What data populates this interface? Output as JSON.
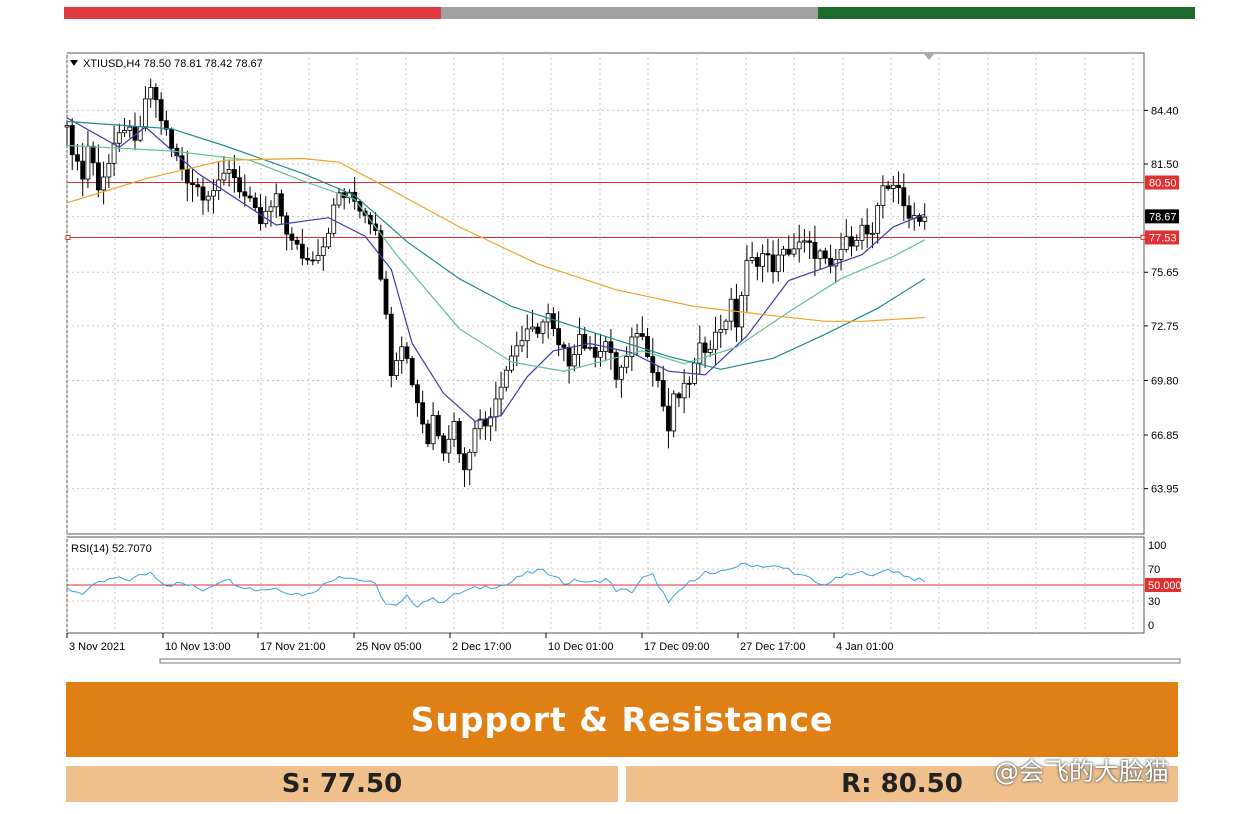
{
  "colors": {
    "bar_red": "#e0393e",
    "bar_grey": "#a0a0a0",
    "bar_green": "#1e6b2d",
    "banner": "#e07f14",
    "level_box": "#f0c08c",
    "level_line": "#e23030",
    "ma_fast": "#3b3bb0",
    "ma_mid": "#5cc494",
    "ma_slow": "#1e8c8c",
    "ma_long": "#f5a020",
    "rsi": "#3d9fe6"
  },
  "chart_data": {
    "type": "candlestick",
    "title": "XTIUSD,H4 78.50 78.81 78.42 78.67",
    "ylim": [
      61.5,
      87.5
    ],
    "y_ticks": [
      "84.40",
      "81.50",
      "78.67",
      "75.65",
      "72.75",
      "69.80",
      "66.85",
      "63.95"
    ],
    "x_ticks": [
      "3 Nov 2021",
      "10 Nov 13:00",
      "17 Nov 21:00",
      "25 Nov 05:00",
      "2 Dec 17:00",
      "10 Dec 01:00",
      "17 Dec 09:00",
      "27 Dec 17:00",
      "4 Jan 01:00"
    ],
    "close_path": [
      [
        0,
        83.2
      ],
      [
        3,
        80.8
      ],
      [
        4,
        82.5
      ],
      [
        6,
        80.4
      ],
      [
        8,
        81.5
      ],
      [
        11,
        83.6
      ],
      [
        13,
        82.5
      ],
      [
        16,
        85.7
      ],
      [
        18,
        84.0
      ],
      [
        20,
        82.3
      ],
      [
        23,
        80.8
      ],
      [
        26,
        80.0
      ],
      [
        29,
        80.2
      ],
      [
        31,
        81.4
      ],
      [
        34,
        79.7
      ],
      [
        37,
        78.3
      ],
      [
        40,
        79.5
      ],
      [
        43,
        77.2
      ],
      [
        46,
        76.3
      ],
      [
        49,
        77.2
      ],
      [
        52,
        79.9
      ],
      [
        55,
        79.5
      ],
      [
        57,
        78.9
      ],
      [
        59,
        78.2
      ],
      [
        61,
        73.1
      ],
      [
        62,
        70.5
      ],
      [
        64,
        72.0
      ],
      [
        67,
        68.7
      ],
      [
        69,
        66.5
      ],
      [
        70,
        67.9
      ],
      [
        72,
        66.3
      ],
      [
        74,
        67.5
      ],
      [
        76,
        64.8
      ],
      [
        78,
        67.6
      ],
      [
        80,
        67.4
      ],
      [
        83,
        69.8
      ],
      [
        86,
        71.8
      ],
      [
        89,
        72.4
      ],
      [
        92,
        73.2
      ],
      [
        94,
        71.5
      ],
      [
        96,
        70.9
      ],
      [
        98,
        72.3
      ],
      [
        100,
        71.2
      ],
      [
        103,
        71.9
      ],
      [
        105,
        70.0
      ],
      [
        107,
        70.9
      ],
      [
        109,
        72.6
      ],
      [
        111,
        71.5
      ],
      [
        113,
        69.8
      ],
      [
        115,
        67.1
      ],
      [
        116,
        68.7
      ],
      [
        118,
        69.2
      ],
      [
        120,
        70.5
      ],
      [
        121,
        71.4
      ],
      [
        124,
        72.2
      ],
      [
        127,
        73.8
      ],
      [
        128,
        72.9
      ],
      [
        130,
        76.0
      ],
      [
        133,
        76.6
      ],
      [
        135,
        76.0
      ],
      [
        138,
        76.9
      ],
      [
        141,
        77.1
      ],
      [
        144,
        76.6
      ],
      [
        146,
        75.6
      ],
      [
        148,
        76.9
      ],
      [
        150,
        77.5
      ],
      [
        152,
        78.0
      ],
      [
        154,
        77.4
      ],
      [
        156,
        80.3
      ],
      [
        158,
        80.5
      ],
      [
        160,
        79.2
      ],
      [
        162,
        78.7
      ],
      [
        164,
        78.67
      ]
    ],
    "moving_averages": [
      {
        "name": "MA fast",
        "points": [
          [
            0,
            84.0
          ],
          [
            10,
            82.4
          ],
          [
            15,
            83.5
          ],
          [
            25,
            81.0
          ],
          [
            40,
            78.2
          ],
          [
            50,
            78.6
          ],
          [
            57,
            77.6
          ],
          [
            62,
            75.8
          ],
          [
            66,
            71.8
          ],
          [
            72,
            69.1
          ],
          [
            78,
            67.6
          ],
          [
            83,
            67.9
          ],
          [
            88,
            70.0
          ],
          [
            93,
            71.4
          ],
          [
            100,
            71.8
          ],
          [
            108,
            71.3
          ],
          [
            115,
            70.3
          ],
          [
            122,
            70.1
          ],
          [
            130,
            72.2
          ],
          [
            138,
            75.2
          ],
          [
            145,
            75.9
          ],
          [
            152,
            76.6
          ],
          [
            158,
            78.1
          ],
          [
            164,
            78.8
          ]
        ]
      },
      {
        "name": "MA mid",
        "points": [
          [
            0,
            82.5
          ],
          [
            20,
            82.2
          ],
          [
            35,
            81.7
          ],
          [
            45,
            80.6
          ],
          [
            55,
            79.6
          ],
          [
            63,
            76.6
          ],
          [
            75,
            72.6
          ],
          [
            85,
            70.8
          ],
          [
            95,
            70.3
          ],
          [
            110,
            71.4
          ],
          [
            118,
            70.7
          ],
          [
            128,
            71.6
          ],
          [
            138,
            73.5
          ],
          [
            148,
            75.3
          ],
          [
            158,
            76.5
          ],
          [
            164,
            77.4
          ]
        ]
      },
      {
        "name": "MA slow",
        "points": [
          [
            0,
            83.8
          ],
          [
            20,
            83.4
          ],
          [
            30,
            82.5
          ],
          [
            45,
            81.0
          ],
          [
            55,
            79.8
          ],
          [
            65,
            77.3
          ],
          [
            75,
            75.3
          ],
          [
            85,
            73.8
          ],
          [
            95,
            72.9
          ],
          [
            105,
            72.0
          ],
          [
            115,
            71.1
          ],
          [
            125,
            70.4
          ],
          [
            135,
            71.0
          ],
          [
            145,
            72.3
          ],
          [
            155,
            73.7
          ],
          [
            164,
            75.3
          ]
        ]
      },
      {
        "name": "MA long",
        "points": [
          [
            0,
            79.4
          ],
          [
            15,
            80.7
          ],
          [
            30,
            81.7
          ],
          [
            45,
            81.8
          ],
          [
            52,
            81.6
          ],
          [
            62,
            80.1
          ],
          [
            75,
            78.1
          ],
          [
            90,
            76.1
          ],
          [
            105,
            74.7
          ],
          [
            120,
            73.8
          ],
          [
            135,
            73.3
          ],
          [
            145,
            73.0
          ],
          [
            152,
            73.0
          ],
          [
            164,
            73.2
          ]
        ]
      }
    ],
    "current_price": "78.67",
    "levels": [
      {
        "label": "80.50",
        "value": 80.5
      },
      {
        "label": "77.53",
        "value": 77.53
      }
    ],
    "rsi": {
      "label": "RSI(14) 52.7070",
      "ticks": [
        "100",
        "70",
        "50.000",
        "30",
        "0"
      ],
      "ylim": [
        0,
        100
      ],
      "level": 50,
      "values": [
        [
          0,
          45
        ],
        [
          3,
          40
        ],
        [
          6,
          52
        ],
        [
          9,
          58
        ],
        [
          12,
          57
        ],
        [
          16,
          66
        ],
        [
          19,
          50
        ],
        [
          22,
          52
        ],
        [
          26,
          44
        ],
        [
          30,
          58
        ],
        [
          33,
          50
        ],
        [
          36,
          44
        ],
        [
          40,
          46
        ],
        [
          43,
          40
        ],
        [
          46,
          38
        ],
        [
          49,
          50
        ],
        [
          52,
          62
        ],
        [
          55,
          58
        ],
        [
          57,
          55
        ],
        [
          59,
          50
        ],
        [
          61,
          26
        ],
        [
          63,
          23
        ],
        [
          65,
          35
        ],
        [
          67,
          25
        ],
        [
          69,
          32
        ],
        [
          72,
          30
        ],
        [
          75,
          40
        ],
        [
          77,
          44
        ],
        [
          80,
          48
        ],
        [
          84,
          50
        ],
        [
          87,
          62
        ],
        [
          90,
          68
        ],
        [
          93,
          64
        ],
        [
          95,
          52
        ],
        [
          98,
          56
        ],
        [
          100,
          52
        ],
        [
          103,
          58
        ],
        [
          105,
          44
        ],
        [
          108,
          42
        ],
        [
          110,
          58
        ],
        [
          112,
          62
        ],
        [
          114,
          40
        ],
        [
          115,
          26
        ],
        [
          117,
          42
        ],
        [
          120,
          58
        ],
        [
          122,
          66
        ],
        [
          124,
          62
        ],
        [
          127,
          72
        ],
        [
          130,
          76
        ],
        [
          133,
          74
        ],
        [
          136,
          72
        ],
        [
          138,
          70
        ],
        [
          140,
          62
        ],
        [
          142,
          58
        ],
        [
          144,
          50
        ],
        [
          146,
          54
        ],
        [
          148,
          60
        ],
        [
          151,
          64
        ],
        [
          153,
          66
        ],
        [
          155,
          62
        ],
        [
          157,
          70
        ],
        [
          159,
          66
        ],
        [
          161,
          60
        ],
        [
          163,
          56
        ],
        [
          164,
          53
        ]
      ]
    }
  },
  "banner": {
    "title": "Support & Resistance"
  },
  "levels_panel": {
    "support": "S: 77.50",
    "resistance": "R: 80.50"
  },
  "watermark": {
    "text": "@会飞的大脸猫"
  }
}
